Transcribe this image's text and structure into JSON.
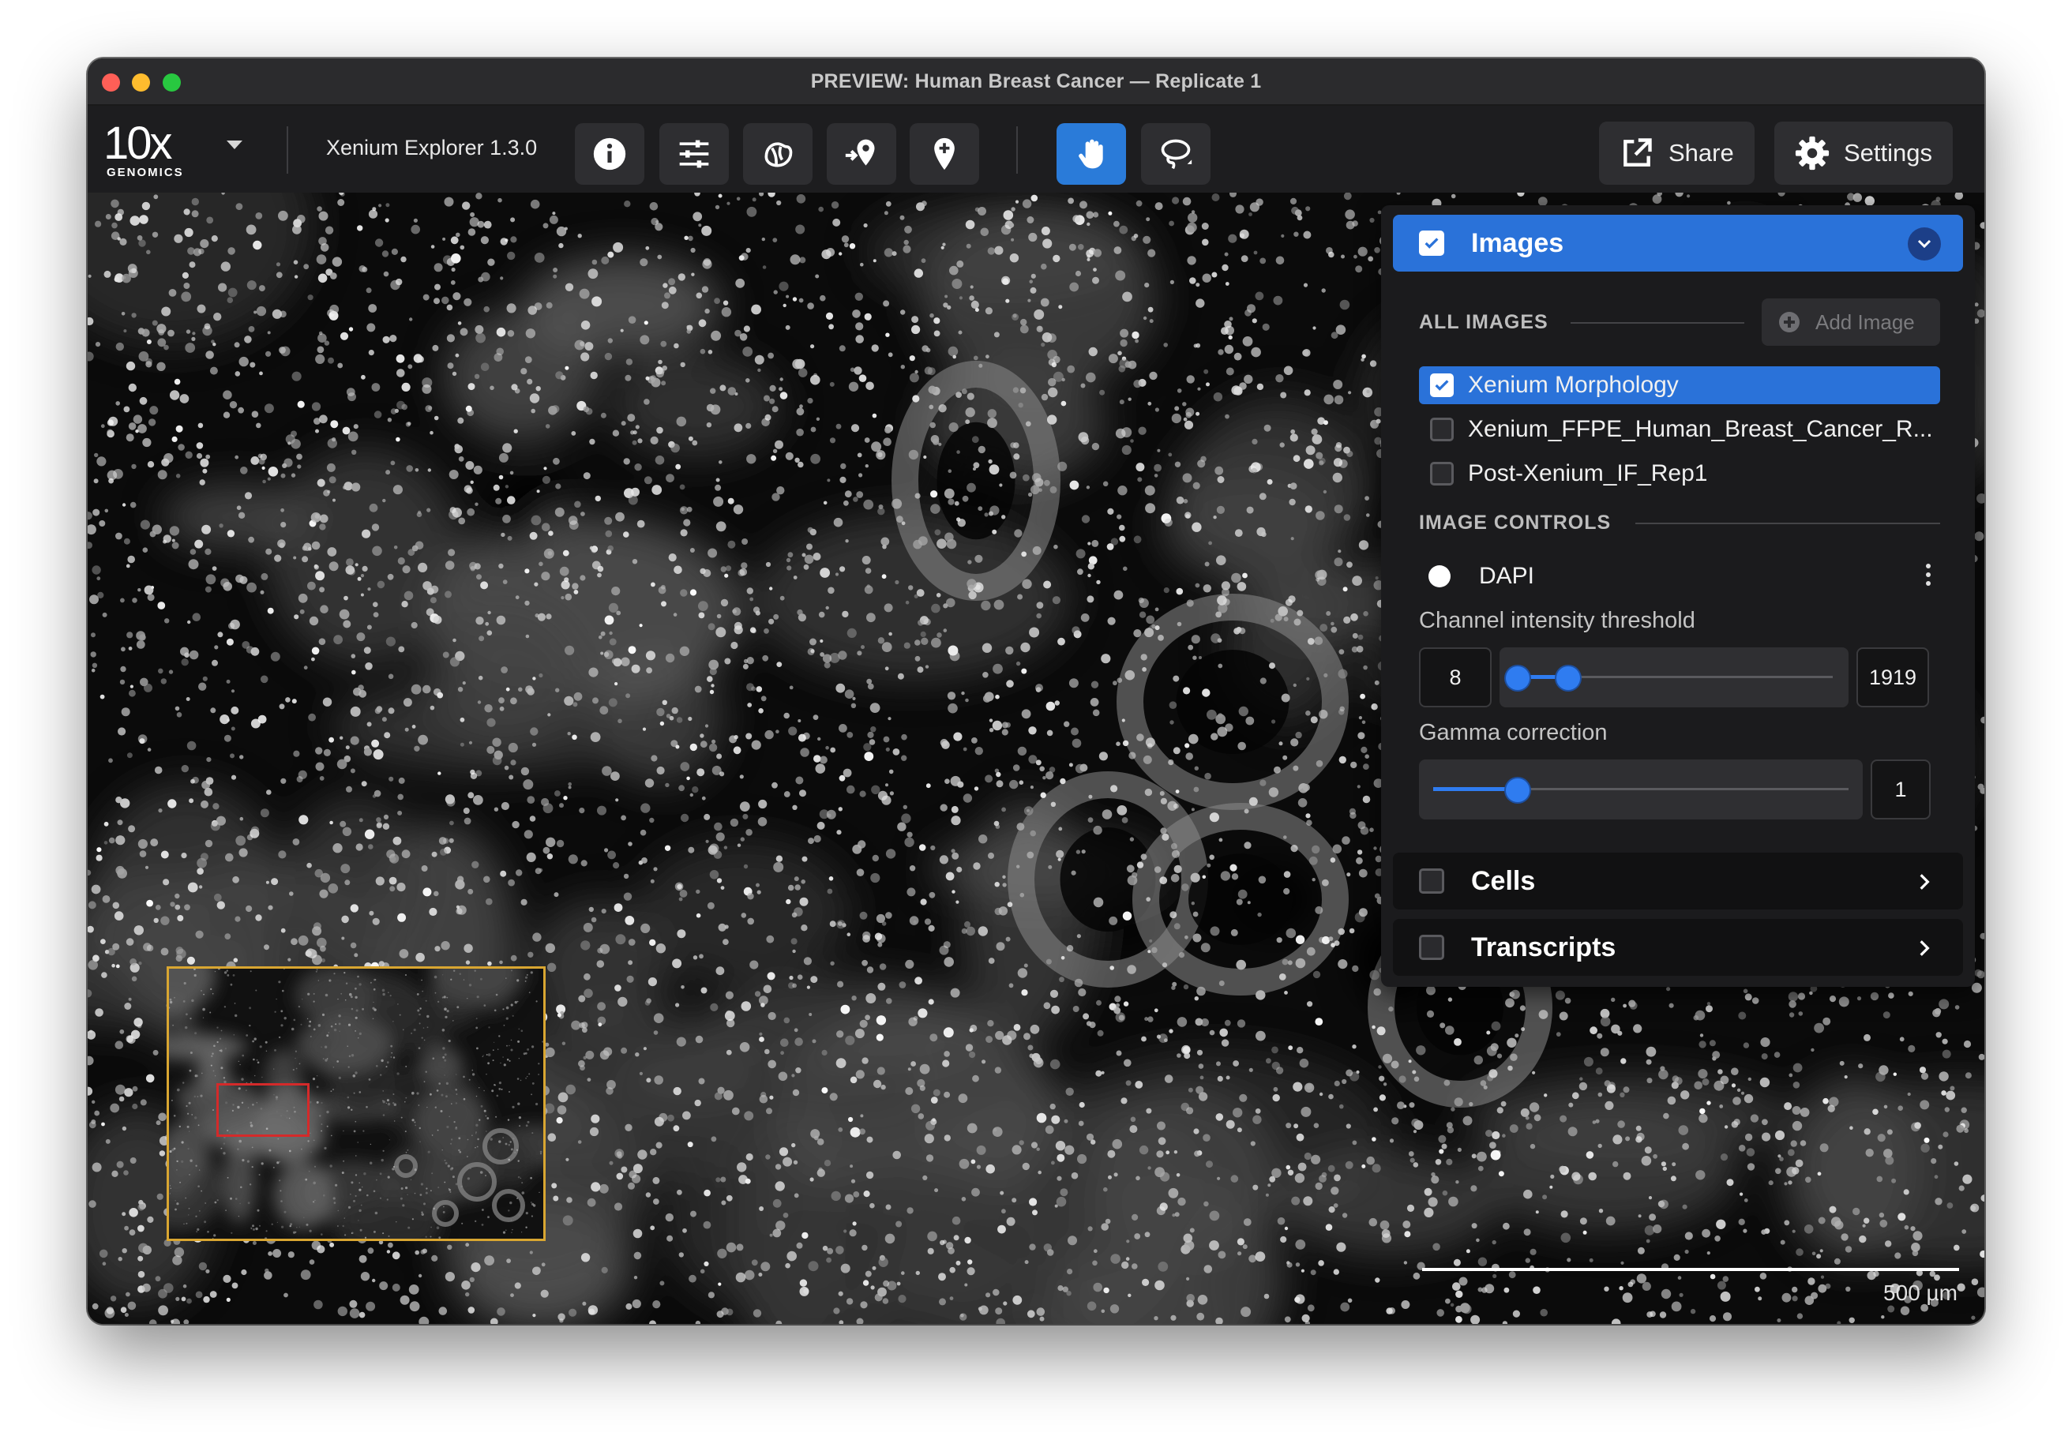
{
  "window": {
    "title": "PREVIEW: Human Breast Cancer — Replicate 1"
  },
  "toolbar": {
    "logo_main": "10x",
    "logo_sub": "GENOMICS",
    "version": "Xenium Explorer 1.3.0",
    "tools": [
      "info-icon",
      "sliders-icon",
      "gene-icon",
      "pin-arrow-icon",
      "pin-add-icon",
      "hand-pan-icon",
      "lasso-icon"
    ],
    "active_tool": "hand-pan-icon",
    "share_label": "Share",
    "settings_label": "Settings"
  },
  "panel": {
    "images": {
      "title": "Images",
      "checked": true,
      "expanded": true,
      "all_images_label": "ALL IMAGES",
      "add_image_label": "Add Image",
      "items": [
        {
          "label": "Xenium Morphology",
          "checked": true,
          "selected": true
        },
        {
          "label": "Xenium_FFPE_Human_Breast_Cancer_R...",
          "checked": false,
          "selected": false
        },
        {
          "label": "Post-Xenium_IF_Rep1",
          "checked": false,
          "selected": false
        }
      ],
      "image_controls_label": "IMAGE CONTROLS",
      "channel": {
        "name": "DAPI",
        "color": "#ffffff"
      },
      "threshold": {
        "label": "Channel intensity threshold",
        "min_value": "8",
        "max_value": "1919"
      },
      "gamma": {
        "label": "Gamma correction",
        "value": "1"
      }
    },
    "cells": {
      "title": "Cells",
      "checked": false
    },
    "transcripts": {
      "title": "Transcripts",
      "checked": false
    }
  },
  "viewer": {
    "scale_label": "500 µm"
  },
  "colors": {
    "accent": "#2a72d9",
    "minimap_border": "#d9a631",
    "minimap_view": "#d42a2a"
  }
}
